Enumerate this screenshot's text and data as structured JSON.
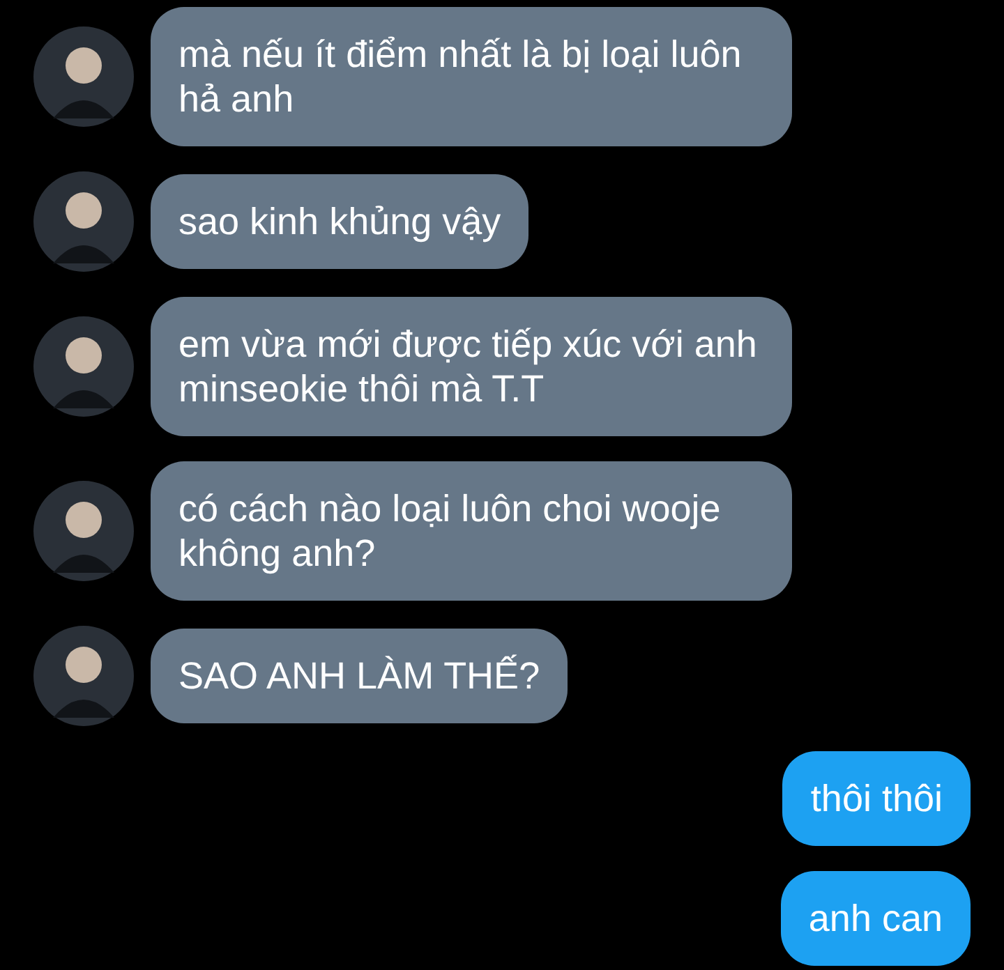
{
  "messages": [
    {
      "kind": "incoming",
      "text": "mà nếu ít điểm nhất là bị loại luôn hả anh"
    },
    {
      "kind": "incoming",
      "text": "sao kinh khủng vậy"
    },
    {
      "kind": "incoming",
      "text": "em vừa mới được tiếp xúc với anh minseokie thôi mà T.T"
    },
    {
      "kind": "incoming",
      "text": "có cách nào loại luôn choi wooje không anh?"
    },
    {
      "kind": "incoming",
      "text": "SAO ANH LÀM THẾ?"
    },
    {
      "kind": "outgoing",
      "text": "thôi thôi"
    },
    {
      "kind": "outgoing",
      "text": "anh can"
    }
  ]
}
